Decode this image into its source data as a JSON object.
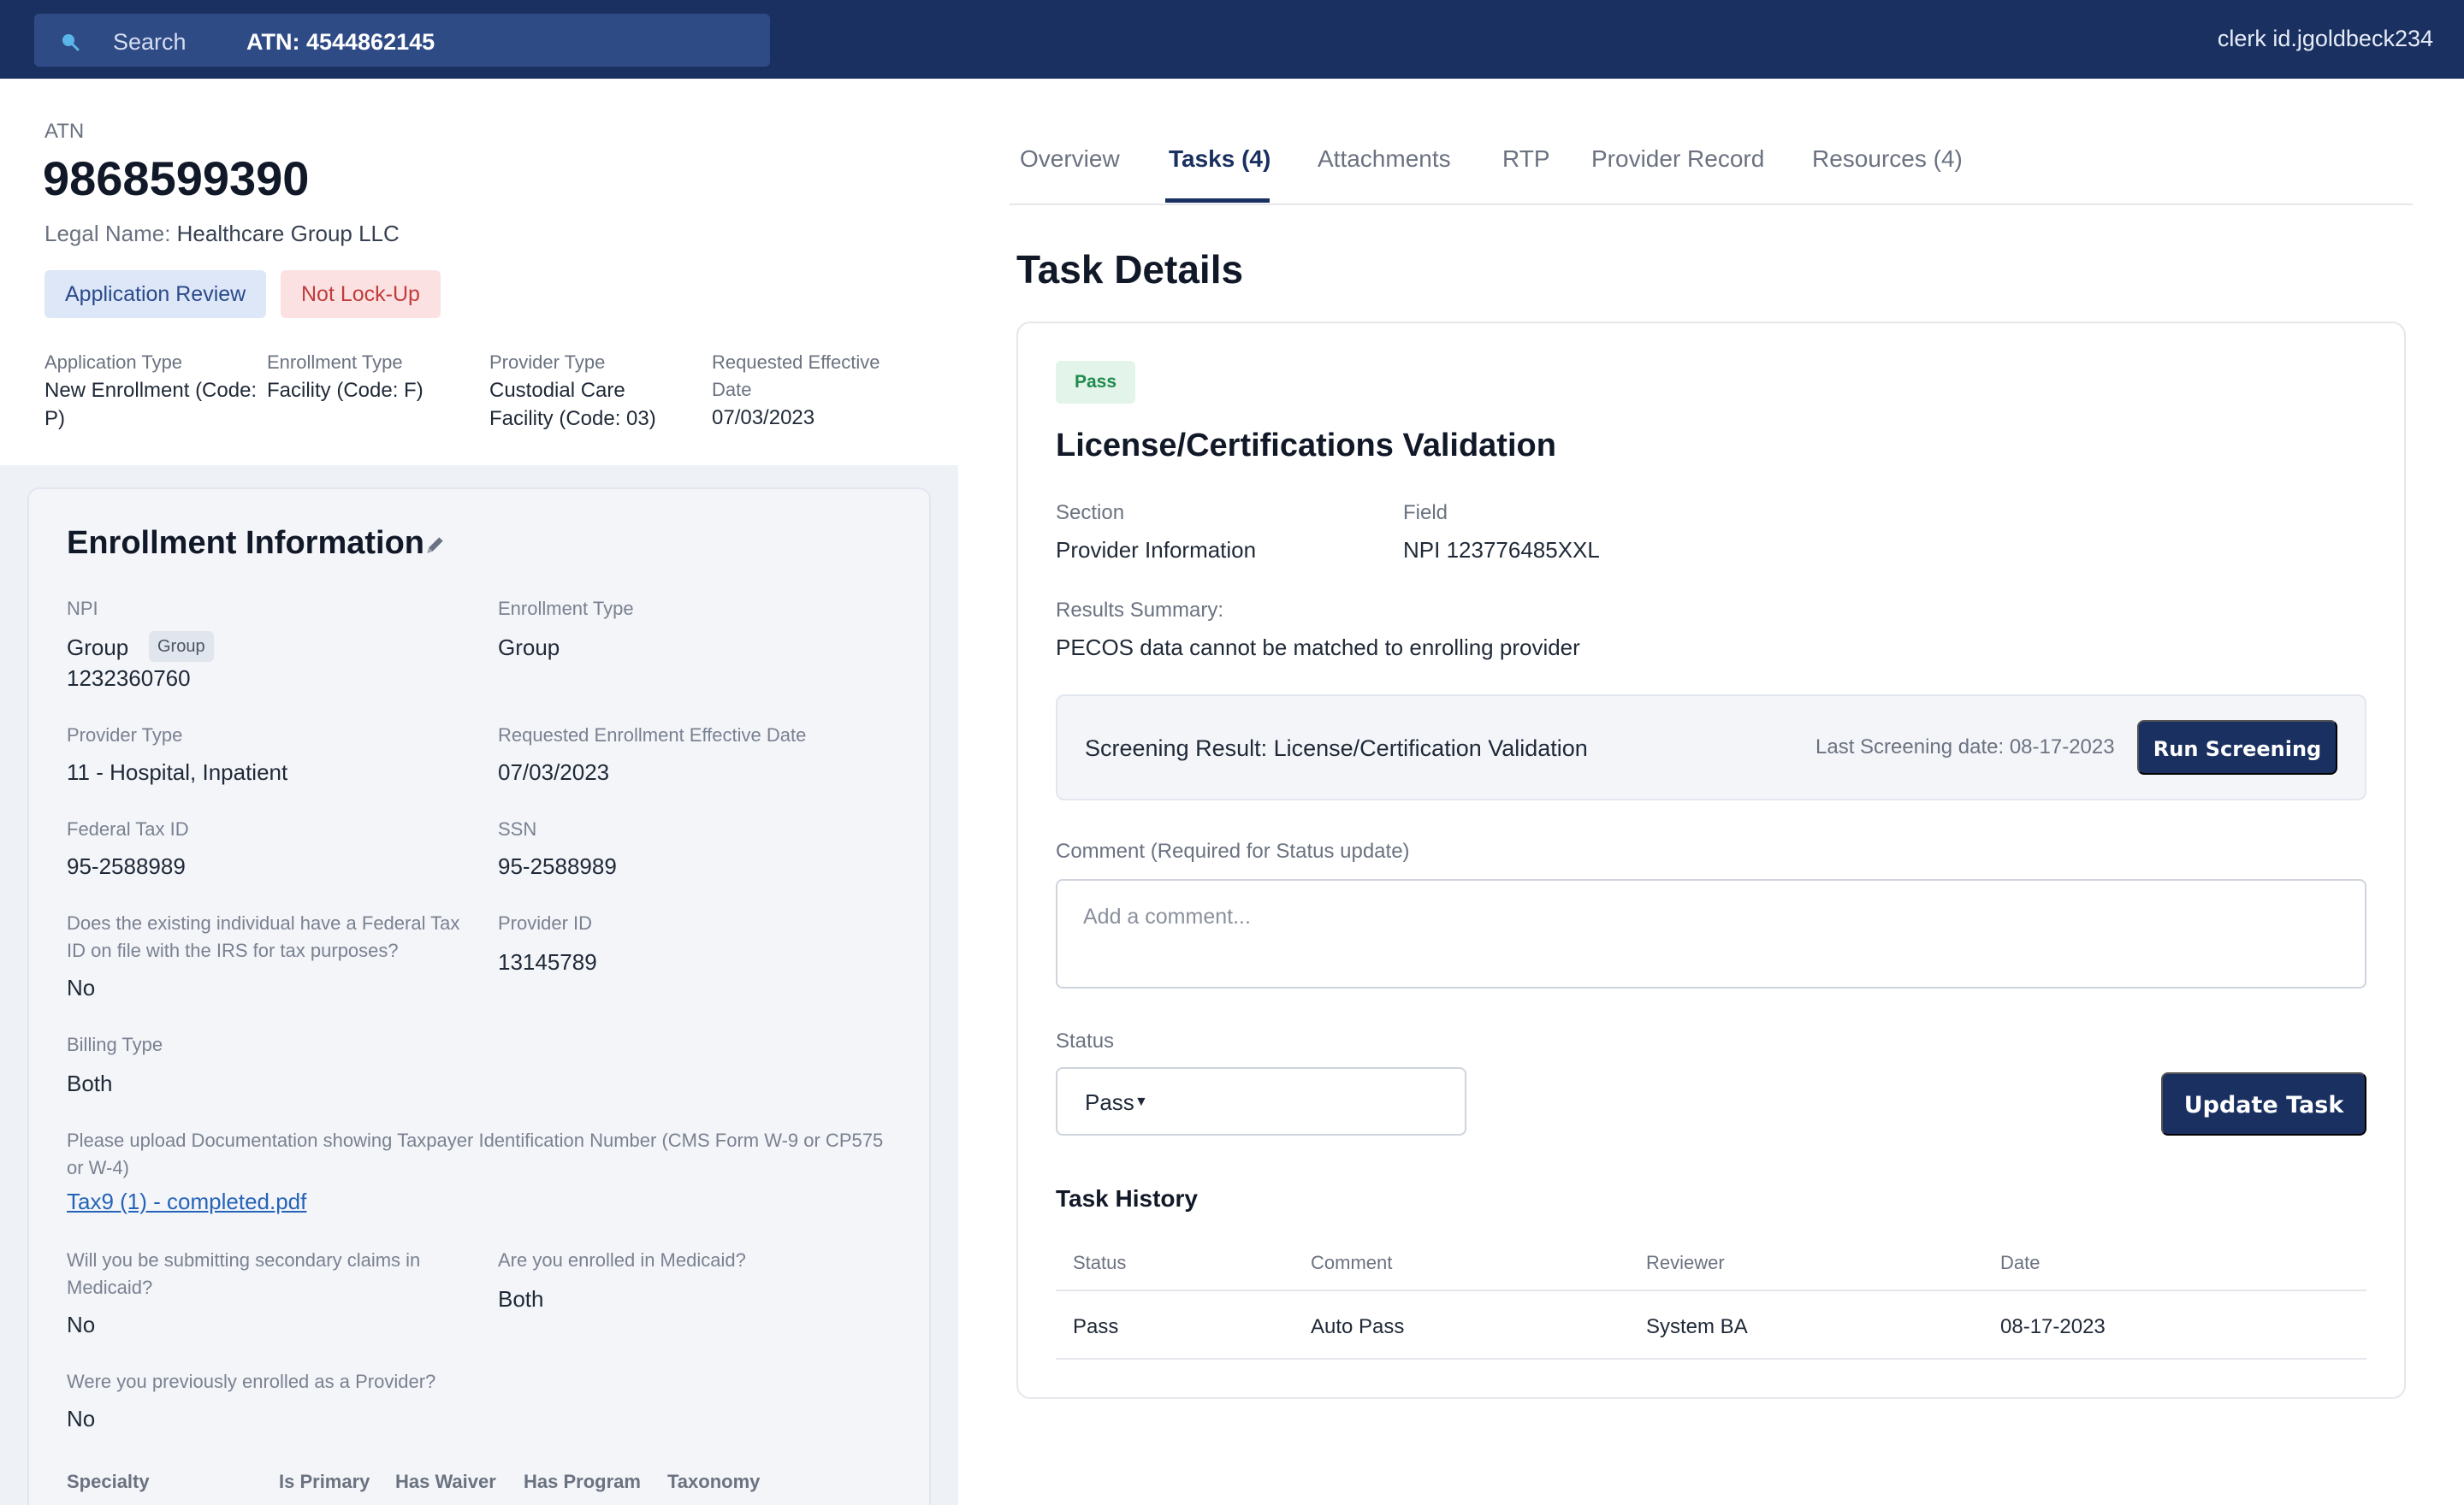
{
  "topbar": {
    "search_label": "Search",
    "search_value": "ATN: 4544862145",
    "user": "clerk id.jgoldbeck234"
  },
  "header": {
    "atn_label": "ATN",
    "atn_number": "9868599390",
    "legal_name_label": "Legal Name:",
    "legal_name": "Healthcare Group LLC",
    "badges": [
      "Application Review",
      "Not Lock-Up"
    ],
    "meta": [
      {
        "label": "Application Type",
        "value": "New Enrollment (Code: P)"
      },
      {
        "label": "Enrollment Type",
        "value": "Facility (Code: F)"
      },
      {
        "label": "Provider Type",
        "value": "Custodial Care Facility (Code: 03)"
      },
      {
        "label": "Requested Effective Date",
        "value": "07/03/2023"
      }
    ]
  },
  "enrollment": {
    "title": "Enrollment Information",
    "npi_label": "NPI",
    "npi_value": "Group",
    "npi_chip": "Group",
    "npi_number": "1232360760",
    "enrollment_type_label": "Enrollment Type",
    "enrollment_type_value": "Group",
    "provider_type_label": "Provider Type",
    "provider_type_value": "11 - Hospital, Inpatient",
    "req_date_label": "Requested Enrollment Effective Date",
    "req_date_value": "07/03/2023",
    "tax_id_label": "Federal Tax ID",
    "tax_id_value": "95-2588989",
    "ssn_label": "SSN",
    "ssn_value": "95-2588989",
    "irs_question": "Does the existing individual have a Federal Tax ID on file with the IRS for tax purposes?",
    "irs_answer": "No",
    "provider_id_label": "Provider ID",
    "provider_id_value": "13145789",
    "billing_label": "Billing Type",
    "billing_value": "Both",
    "upload_label": "Please upload Documentation showing Taxpayer Identification Number (CMS Form W-9 or CP575 or W-4)",
    "upload_link": "Tax9 (1) - completed.pdf",
    "secondary_q": "Will you be submitting secondary claims in Medicaid?",
    "secondary_a": "No",
    "medicaid_q": "Are you enrolled in Medicaid?",
    "medicaid_a": "Both",
    "prev_q": "Were you previously enrolled as a Provider?",
    "prev_a": "No",
    "specialty_headers": [
      "Specialty",
      "Is Primary",
      "Has Waiver",
      "Has Program",
      "Taxonomy"
    ]
  },
  "tabs": [
    "Overview",
    "Tasks (4)",
    "Attachments",
    "RTP",
    "Provider Record",
    "Resources (4)"
  ],
  "task": {
    "heading": "Task Details",
    "status_badge": "Pass",
    "title": "License/Certifications Validation",
    "section_label": "Section",
    "section_value": "Provider Information",
    "field_label": "Field",
    "field_value": "NPI 123776485XXL",
    "results_label": "Results Summary:",
    "results_value": "PECOS data cannot be matched to enrolling provider",
    "screening_result": "Screening Result: License/Certification Validation",
    "last_screening": "Last Screening date: 08-17-2023",
    "run_button": "Run Screening",
    "comment_label": "Comment (Required for Status update)",
    "comment_placeholder": "Add a comment...",
    "status_label": "Status",
    "status_value": "Pass",
    "update_button": "Update Task",
    "history_title": "Task History",
    "history_headers": [
      "Status",
      "Comment",
      "Reviewer",
      "Date"
    ],
    "history_rows": [
      [
        "Pass",
        "Auto Pass",
        "System BA",
        "08-17-2023"
      ]
    ]
  },
  "colors": {
    "navy": "#1a3061",
    "pass_green": "#1f8a4c",
    "alert_red": "#c23c3c",
    "link_blue": "#2563b8"
  }
}
